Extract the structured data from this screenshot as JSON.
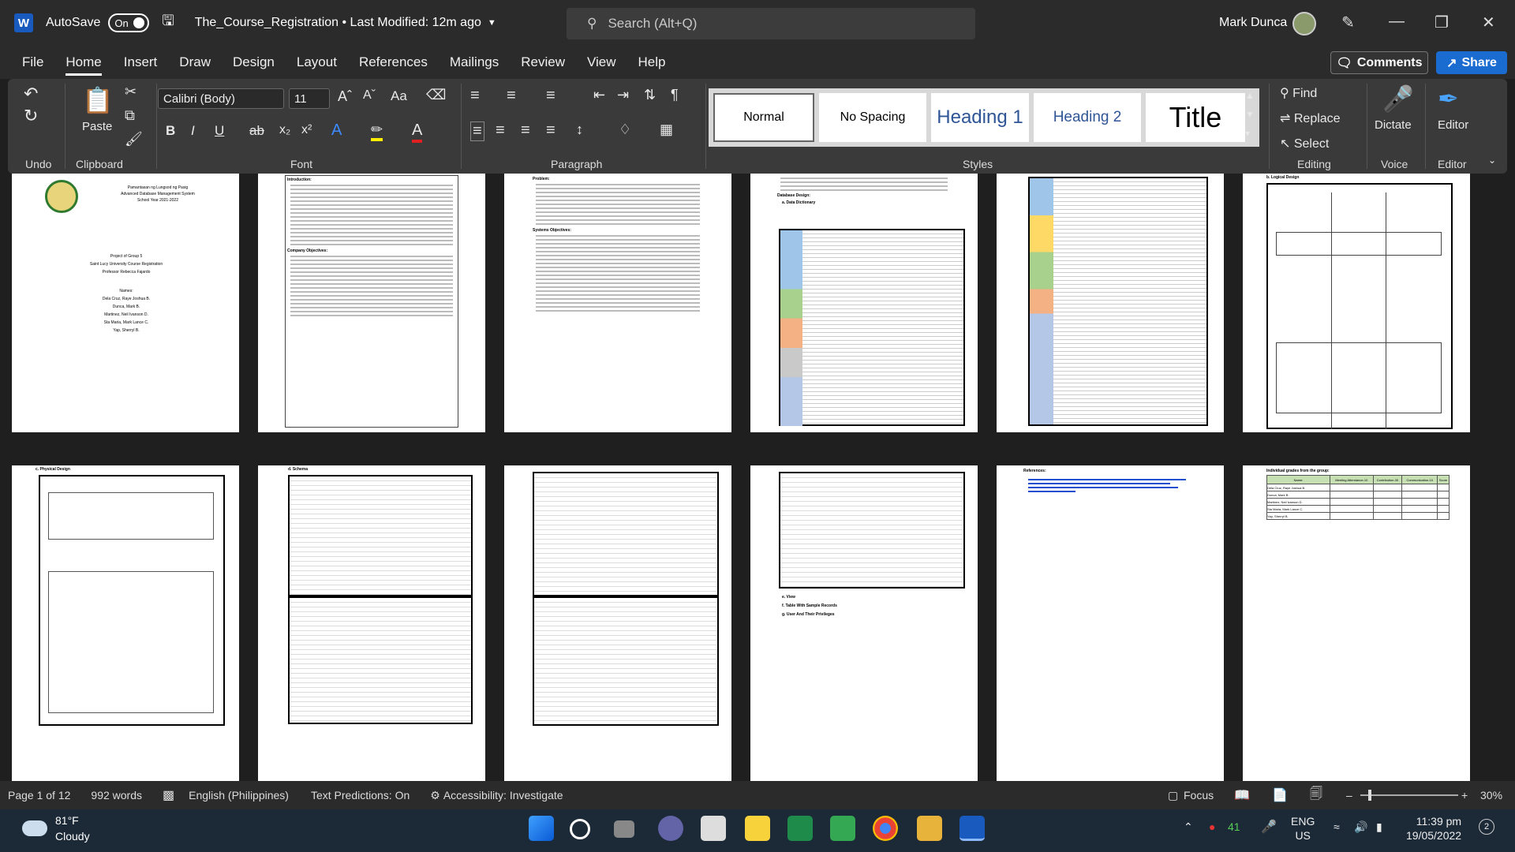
{
  "titlebar": {
    "app_letter": "W",
    "autosave_label": "AutoSave",
    "autosave_state": "On",
    "doc_title": "The_Course_Registration • Last Modified: 12m ago",
    "search_placeholder": "Search (Alt+Q)",
    "user_name": "Mark Dunca"
  },
  "menu": {
    "items": [
      "File",
      "Home",
      "Insert",
      "Draw",
      "Design",
      "Layout",
      "References",
      "Mailings",
      "Review",
      "View",
      "Help"
    ],
    "comments_label": "Comments",
    "share_label": "Share"
  },
  "ribbon": {
    "groups": [
      "Undo",
      "Clipboard",
      "Font",
      "Paragraph",
      "Styles",
      "Editing",
      "Voice",
      "Editor"
    ],
    "paste_label": "Paste",
    "font_name": "Calibri (Body)",
    "font_size": "11",
    "styles": [
      "Normal",
      "No Spacing",
      "Heading 1",
      "Heading 2",
      "Title"
    ],
    "find_label": "Find",
    "replace_label": "Replace",
    "select_label": "Select",
    "dictate_label": "Dictate",
    "editor_label": "Editor",
    "case_label": "Aa"
  },
  "pages": {
    "p1": [
      "Pamantasan ng Lungsod ng Pasig",
      "Advanced Database Management System",
      "School Year 2021-2022",
      "Project of Group 5",
      "Saint Lucy University Course Registration",
      "Professor Rebecca Fajardo",
      "Names:",
      "Dela Cruz, Raye Joshua B.",
      "Dunca, Mark B.",
      "Martinez, Neil Ivanson D.",
      "Sta Maria, Mark Lance C.",
      "Yap, Sherryl B."
    ],
    "p2_heading": "Introduction:",
    "p2_heading2": "Company Objectives:",
    "p3_heading": "Problem:",
    "p3_heading2": "Systems Objectives:",
    "p4_heading": "Database Design:",
    "p4_sub": "a.  Data Dictionary",
    "p6_heading": "b.  Logical Design",
    "p7_heading": "c.  Physical Design",
    "p8_heading": "d.  Schema",
    "p10_items": [
      "e.  View",
      "f.   Table With Sample Records",
      "g.  User And Their Privileges"
    ],
    "p11_heading": "References:",
    "p12_heading": "Individual grades from the group:",
    "p12_cols": [
      "Name:",
      "Meeting Attendance-10",
      "Contribution-30",
      "Communication-10",
      "Score"
    ],
    "p12_rows": [
      "Dela Cruz, Raye Joshua B.",
      "Dunca, Mark B.",
      "Martinez, Neil Ivanson D.",
      "Sta Maria, Mark Lance C.",
      "Yap, Sherryl B."
    ]
  },
  "status": {
    "page": "Page 1 of 12",
    "words": "992 words",
    "language": "English (Philippines)",
    "predictions": "Text Predictions: On",
    "accessibility": "Accessibility: Investigate",
    "focus": "Focus",
    "zoom": "30%"
  },
  "taskbar": {
    "temp": "81°F",
    "condition": "Cloudy",
    "lang_top": "ENG",
    "lang_bottom": "US",
    "time": "11:39 pm",
    "date": "19/05/2022",
    "notif": "41",
    "badge": "2"
  },
  "colors": {
    "accent": "#1b6cd1",
    "ribbon": "#3a3a3a",
    "titlebar": "#2b2b2b",
    "taskbar": "#1c2a38"
  }
}
